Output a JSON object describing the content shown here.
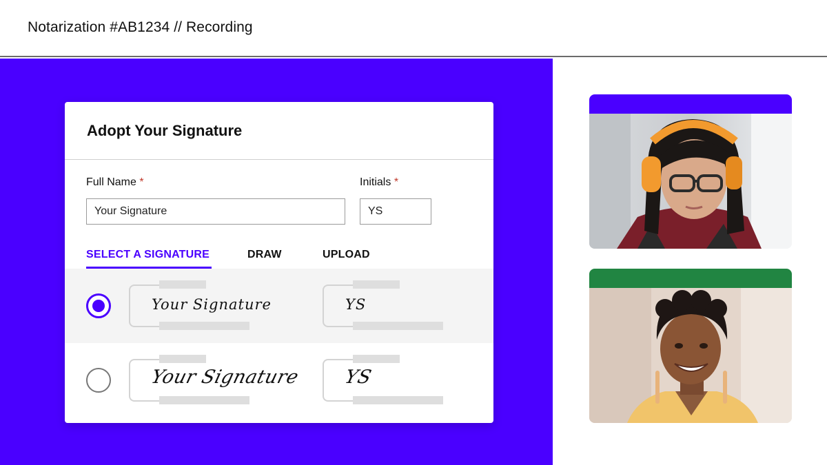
{
  "header": {
    "title": "Notarization #AB1234 // Recording"
  },
  "card": {
    "title": "Adopt Your Signature",
    "full_name": {
      "label": "Full Name",
      "required_mark": "*",
      "value": "Your Signature"
    },
    "initials": {
      "label": "Initials",
      "required_mark": "*",
      "value": "YS"
    },
    "tabs": [
      {
        "label": "SELECT A SIGNATURE",
        "active": true
      },
      {
        "label": "DRAW",
        "active": false
      },
      {
        "label": "UPLOAD",
        "active": false
      }
    ],
    "options": [
      {
        "signature": "Your Signature",
        "initials": "YS",
        "selected": true
      },
      {
        "signature": "Your Signature",
        "initials": "YS",
        "selected": false
      }
    ]
  },
  "participants": [
    {
      "band_color": "#4a00ff",
      "icon": "participant-video-icon"
    },
    {
      "band_color": "#218542",
      "icon": "participant-video-icon"
    }
  ],
  "colors": {
    "accent": "#4a00ff",
    "required": "#c0392b",
    "stage_bg": "#4a00ff"
  }
}
